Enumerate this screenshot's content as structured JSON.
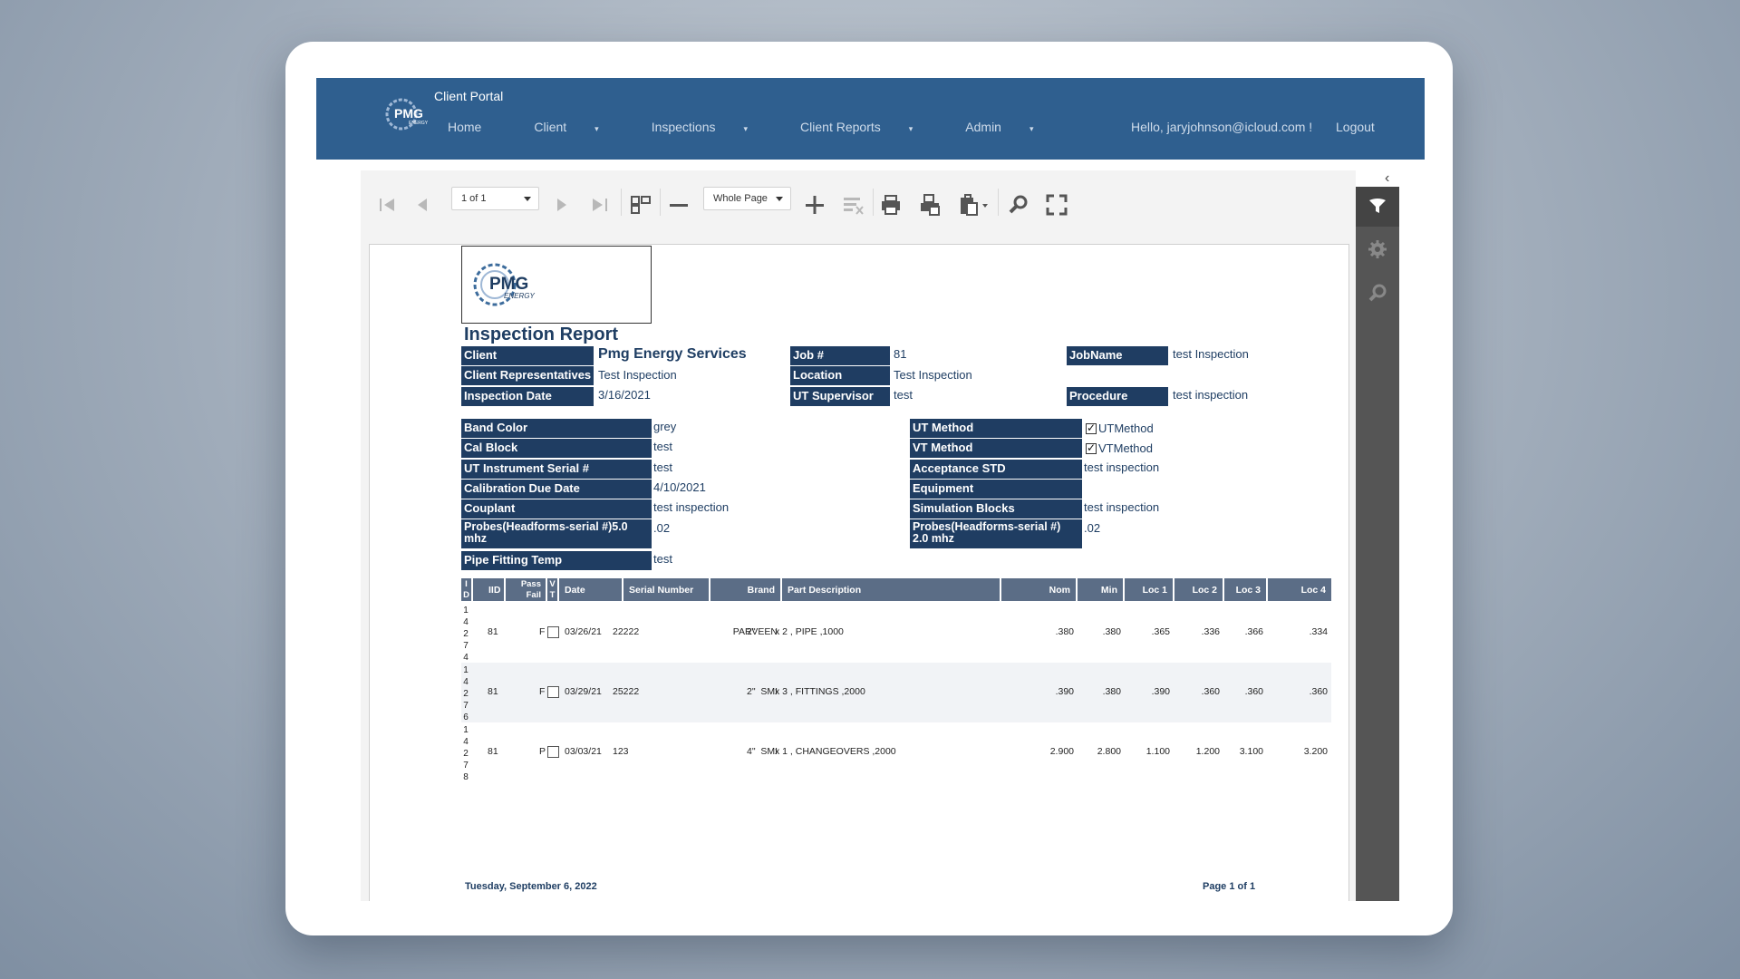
{
  "nav": {
    "portal_title": "Client Portal",
    "items": [
      {
        "label": "Home",
        "dropdown": false
      },
      {
        "label": "Client",
        "dropdown": true
      },
      {
        "label": "Inspections",
        "dropdown": true
      },
      {
        "label": "Client Reports",
        "dropdown": true
      },
      {
        "label": "Admin",
        "dropdown": true
      }
    ],
    "greeting": "Hello, jaryjohnson@icloud.com !",
    "logout": "Logout"
  },
  "toolbar": {
    "page_select": "1 of 1",
    "zoom_select": "Whole Page"
  },
  "report": {
    "logo_text": "PMG",
    "logo_sub": "ENERGY",
    "title": "Inspection Report",
    "header": {
      "client_label": "Client",
      "client": "Pmg Energy Services",
      "reps_label": "Client Representatives",
      "reps": "Test Inspection",
      "date_label": "Inspection Date",
      "date": "3/16/2021",
      "job_label": "Job #",
      "job": "81",
      "location_label": "Location",
      "location": "Test Inspection",
      "supervisor_label": "UT Supervisor",
      "supervisor": "test",
      "jobname_label": "JobName",
      "jobname": "test Inspection",
      "procedure_label": "Procedure",
      "procedure": "test inspection"
    },
    "details_left": [
      {
        "label": "Band Color",
        "value": "grey"
      },
      {
        "label": "Cal Block",
        "value": "test"
      },
      {
        "label": "UT Instrument Serial #",
        "value": "test"
      },
      {
        "label": "Calibration Due Date",
        "value": "4/10/2021"
      },
      {
        "label": "Couplant",
        "value": "test inspection"
      },
      {
        "label": "Probes(Headforms-serial #)5.0 mhz",
        "value": ".02"
      },
      {
        "label": "Pipe Fitting Temp",
        "value": "test"
      }
    ],
    "details_right": [
      {
        "label": "UT Method",
        "value": "UTMethod",
        "checked": true
      },
      {
        "label": "VT Method",
        "value": "VTMethod",
        "checked": true
      },
      {
        "label": "Acceptance STD",
        "value": "test inspection"
      },
      {
        "label": "Equipment",
        "value": ""
      },
      {
        "label": "Simulation Blocks",
        "value": "test inspection"
      },
      {
        "label": "Probes(Headforms-serial #) 2.0 mhz",
        "value": ".02"
      }
    ],
    "columns": {
      "id": "I D",
      "iid": "IID",
      "passfail": "Pass Fail",
      "vt": "V T",
      "date": "Date",
      "serial": "Serial Number",
      "brand": "Brand",
      "part": "Part Description",
      "nom": "Nom",
      "min": "Min",
      "loc1": "Loc 1",
      "loc2": "Loc 2",
      "loc3": "Loc 3",
      "loc4": "Loc 4"
    },
    "rows": [
      {
        "id": "1 4 2 7 4",
        "iid": "81",
        "pf": "F",
        "vt": false,
        "date": "03/26/21",
        "serial": "22222",
        "brand": "PARVEEN",
        "size": "2\"",
        "desc": "x 2 , PIPE ,1000",
        "nom": ".380",
        "min": ".380",
        "loc1": ".365",
        "loc2": ".336",
        "loc3": ".366",
        "loc4": ".334"
      },
      {
        "id": "1 4 2 7 6",
        "iid": "81",
        "pf": "F",
        "vt": false,
        "date": "03/29/21",
        "serial": "25222",
        "brand": "SMI",
        "size": "2\"",
        "desc": "x 3 , FITTINGS ,2000",
        "nom": ".390",
        "min": ".380",
        "loc1": ".390",
        "loc2": ".360",
        "loc3": ".360",
        "loc4": ".360"
      },
      {
        "id": "1 4 2 7 8",
        "iid": "81",
        "pf": "P",
        "vt": false,
        "date": "03/03/21",
        "serial": "123",
        "brand": "SMI",
        "size": "4\"",
        "desc": "x 1 , CHANGEOVERS ,2000",
        "nom": "2.900",
        "min": "2.800",
        "loc1": "1.100",
        "loc2": "1.200",
        "loc3": "3.100",
        "loc4": "3.200"
      }
    ],
    "footer_date": "Tuesday, September 6, 2022",
    "footer_page": "Page 1 of 1"
  }
}
